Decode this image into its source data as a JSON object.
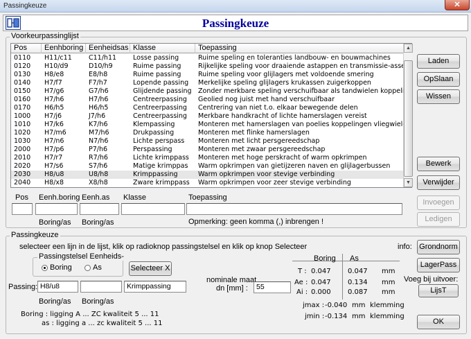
{
  "window": {
    "title": "Passingkeuze",
    "close_glyph": "✕"
  },
  "header": {
    "title": "Passingkeuze",
    "icon": "app-icon"
  },
  "list_group": {
    "label": "Voorkeurpassinglijst"
  },
  "list": {
    "columns": [
      "Pos",
      "Eenhboring",
      "Eenheidsas",
      "Klasse",
      "Toepassing"
    ],
    "rows": [
      [
        "0110",
        "H11/c11",
        "C11/h11",
        "Losse passing",
        "Ruime speling en toleranties landbouw- en bouwmachines"
      ],
      [
        "0120",
        "H10/d9",
        "D10/h9",
        "Ruime passing",
        "Rijkelijke speling voor draaiende astappen en transmissie-assen"
      ],
      [
        "0130",
        "H8/e8",
        "E8/h8",
        "Ruime passing",
        "Ruime speling voor glijlagers met voldoende smering"
      ],
      [
        "0140",
        "H7/f7",
        "F7/h7",
        "Lopende passing",
        "Merkelijke speling glijlagers krukassen zuigerkoppen"
      ],
      [
        "0150",
        "H7/g6",
        "G7/h6",
        "Glijdende passing",
        "Zonder merkbare speling verschuifbaar als tandwielen koppelingen"
      ],
      [
        "0160",
        "H7/h6",
        "H7/h6",
        "Centreerpassing",
        "Geolied nog juist met hand verschuifbaar"
      ],
      [
        "0170",
        "H6/h5",
        "H6/h5",
        "Centreerpassing",
        "Centrering van niet t.o. elkaar bewegende delen"
      ],
      [
        "1000",
        "H7/j6",
        "J7/h6",
        "Centreerpassing",
        "Merkbare handkracht of lichte hamerslagen vereist"
      ],
      [
        "1010",
        "H7/k6",
        "K7/h6",
        "Klempassing",
        "Monteren met hamerslagen van poelies koppelingen vliegwielen"
      ],
      [
        "1020",
        "H7/m6",
        "M7/h6",
        "Drukpassing",
        "Monteren met flinke hamerslagen"
      ],
      [
        "1030",
        "H7/n6",
        "N7/h6",
        "Lichte perspass",
        "Monteren met licht persgereedschap"
      ],
      [
        "2000",
        "H7/p6",
        "P7/h6",
        "Perspassing",
        "Monteren met zwaar persgereedschap"
      ],
      [
        "2010",
        "H7/r7",
        "R7/h6",
        "Lichte krimppass",
        "Monteren met hoge perskracht of warm opkrimpen"
      ],
      [
        "2020",
        "H7/s6",
        "S7/h6",
        "Matige krimppas",
        "Warm opkrimpen van gietijzeren naven en glijlagerbussen"
      ],
      [
        "2030",
        "H8/u8",
        "U8/h8",
        "Krimppassing",
        "Warm opkrimpen voor stevige verbinding"
      ],
      [
        "2040",
        "H8/x8",
        "X8/h8",
        "Zware krimppass",
        "Warm opkrimpen voor zeer stevige verbinding"
      ]
    ],
    "selected_index": 14
  },
  "side_buttons": {
    "laden": "Laden",
    "opslaan": "OpSlaan",
    "wissen": "Wissen",
    "bewerk": "Bewerk",
    "verwijder": "Verwijder",
    "invoegen": "Invoegen",
    "ledigen": "Ledigen"
  },
  "edit_row": {
    "labels": {
      "pos": "Pos",
      "eenh_boring": "Eenh.boring",
      "eenh_as": "Eenh.as",
      "klasse": "Klasse",
      "toepassing": "Toepassing"
    },
    "values": {
      "pos": "",
      "eenh_boring": "",
      "eenh_as": "",
      "klasse": "",
      "toepassing": ""
    },
    "sub_boring": "Boring/as",
    "sub_as": "Boring/as",
    "remark": "Opmerking: geen komma (,) inbrengen !"
  },
  "passing_group": {
    "label": "Passingkeuze",
    "instruction": "selecteer een lijn in de lijst, klik op radioknop passingstelsel en klik op knop Selecteer",
    "stelsel_label": "Passingstelsel Eenheids-",
    "radio_boring": "Boring",
    "radio_as": "As",
    "radio_selected": "boring",
    "selecteer": "Selecteer X",
    "passing_label": "Passing:",
    "passing_value": "H8/u8",
    "passing_value2": "",
    "passing_klasse": "Krimppassing",
    "sub_boring": "Boring/as",
    "sub_as": "Boring/as",
    "nominale_label1": "nominale maat",
    "nominale_label2": "dn  [mm] :",
    "nominale_value": "55",
    "legend_boring": "Boring : ligging A ... ZC  kwaliteit 5 ... 11",
    "legend_as": "as : ligging a ... zc  kwaliteit 5 ... 11",
    "results": {
      "col_boring": "Boring",
      "col_as": "As",
      "rows": [
        {
          "label": "T :",
          "boring": "0.047",
          "as": "0.047",
          "unit": "mm"
        },
        {
          "label": "Ae :",
          "boring": "0.047",
          "as": "0.134",
          "unit": "mm"
        },
        {
          "label": "Ai :",
          "boring": "0.000",
          "as": "0.087",
          "unit": "mm"
        }
      ],
      "jmax_label": "jmax :",
      "jmax_value": "-0.040",
      "jmax_unit": "mm",
      "jmax_type": "klemming",
      "jmin_label": "jmin :",
      "jmin_value": "-0.134",
      "jmin_unit": "mm",
      "jmin_type": "klemming"
    },
    "info_label": "info:",
    "grondnorm": "Grondnorm",
    "lagerpass": "LagerPass",
    "voeg_label": "Voeg bij uitvoer:",
    "lijst": "LijsT",
    "ok": "OK"
  }
}
